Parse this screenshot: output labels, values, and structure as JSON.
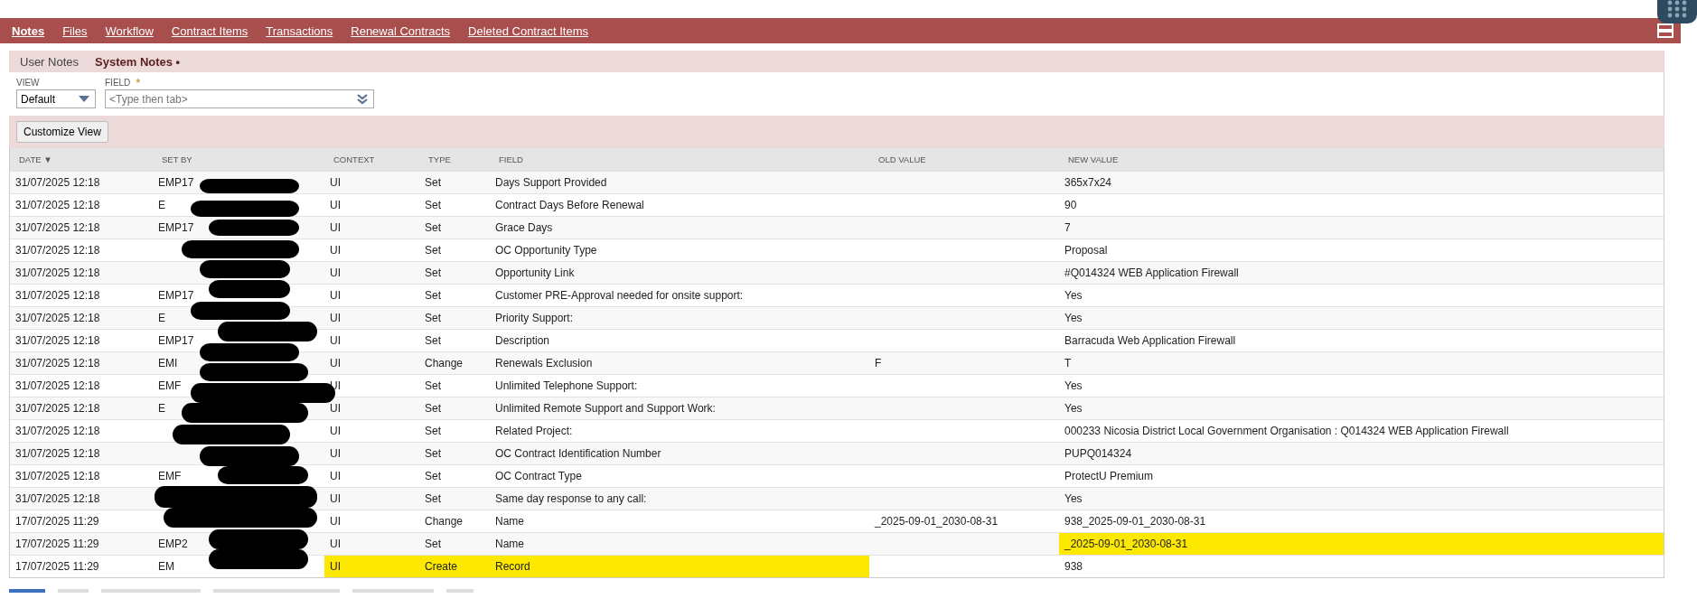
{
  "tabs": [
    {
      "label": "Notes",
      "selected": true
    },
    {
      "label": "Files",
      "selected": false
    },
    {
      "label": "Workflow",
      "selected": false
    },
    {
      "label": "Contract Items",
      "selected": false
    },
    {
      "label": "Transactions",
      "selected": false
    },
    {
      "label": "Renewal Contracts",
      "selected": false
    },
    {
      "label": "Deleted Contract Items",
      "selected": false
    }
  ],
  "subtabs": [
    {
      "label": "User Notes",
      "selected": false
    },
    {
      "label": "System Notes •",
      "selected": true
    }
  ],
  "filters": {
    "view": {
      "label": "VIEW",
      "value": "Default"
    },
    "field": {
      "label": "FIELD",
      "required_mark": "*",
      "placeholder": "<Type then tab>"
    }
  },
  "customize_button": "Customize View",
  "table": {
    "columns": [
      "DATE ▼",
      "SET BY",
      "CONTEXT",
      "TYPE",
      "FIELD",
      "OLD VALUE",
      "NEW VALUE"
    ],
    "rows": [
      {
        "date": "31/07/2025 12:18",
        "set_by": "EMP17",
        "context": "UI",
        "type": "Set",
        "field": "Days Support Provided",
        "old_value": "",
        "new_value": "365x7x24"
      },
      {
        "date": "31/07/2025 12:18",
        "set_by": "E",
        "context": "UI",
        "type": "Set",
        "field": "Contract Days Before Renewal",
        "old_value": "",
        "new_value": "90"
      },
      {
        "date": "31/07/2025 12:18",
        "set_by": "EMP17",
        "context": "UI",
        "type": "Set",
        "field": "Grace Days",
        "old_value": "",
        "new_value": "7"
      },
      {
        "date": "31/07/2025 12:18",
        "set_by": "",
        "context": "UI",
        "type": "Set",
        "field": "OC Opportunity Type",
        "old_value": "",
        "new_value": "Proposal"
      },
      {
        "date": "31/07/2025 12:18",
        "set_by": "",
        "context": "UI",
        "type": "Set",
        "field": "Opportunity Link",
        "old_value": "",
        "new_value": "#Q014324 WEB Application Firewall"
      },
      {
        "date": "31/07/2025 12:18",
        "set_by": "EMP17",
        "context": "UI",
        "type": "Set",
        "field": "Customer PRE-Approval needed for onsite support:",
        "old_value": "",
        "new_value": "Yes"
      },
      {
        "date": "31/07/2025 12:18",
        "set_by": "E",
        "context": "UI",
        "type": "Set",
        "field": "Priority Support:",
        "old_value": "",
        "new_value": "Yes"
      },
      {
        "date": "31/07/2025 12:18",
        "set_by": "EMP17",
        "context": "UI",
        "type": "Set",
        "field": "Description",
        "old_value": "",
        "new_value": "Barracuda Web Application Firewall"
      },
      {
        "date": "31/07/2025 12:18",
        "set_by": "EMI",
        "context": "UI",
        "type": "Change",
        "field": "Renewals Exclusion",
        "old_value": "F",
        "new_value": "T"
      },
      {
        "date": "31/07/2025 12:18",
        "set_by": "EMF",
        "context": "UI",
        "type": "Set",
        "field": "Unlimited Telephone Support:",
        "old_value": "",
        "new_value": "Yes"
      },
      {
        "date": "31/07/2025 12:18",
        "set_by": "E",
        "context": "UI",
        "type": "Set",
        "field": "Unlimited Remote Support and Support Work:",
        "old_value": "",
        "new_value": "Yes"
      },
      {
        "date": "31/07/2025 12:18",
        "set_by": "",
        "context": "UI",
        "type": "Set",
        "field": "Related Project:",
        "old_value": "",
        "new_value": "000233 Nicosia District Local Government Organisation : Q014324 WEB Application Firewall"
      },
      {
        "date": "31/07/2025 12:18",
        "set_by": "",
        "context": "UI",
        "type": "Set",
        "field": "OC Contract Identification Number",
        "old_value": "",
        "new_value": "PUPQ014324"
      },
      {
        "date": "31/07/2025 12:18",
        "set_by": "EMF",
        "context": "UI",
        "type": "Set",
        "field": "OC Contract Type",
        "old_value": "",
        "new_value": "ProtectU Premium"
      },
      {
        "date": "31/07/2025 12:18",
        "set_by": "",
        "context": "UI",
        "type": "Set",
        "field": "Same day response to any call:",
        "old_value": "",
        "new_value": "Yes"
      },
      {
        "date": "17/07/2025 11:29",
        "set_by": "",
        "context": "UI",
        "type": "Change",
        "field": "Name",
        "old_value": "_2025-09-01_2030-08-31",
        "new_value": "938_2025-09-01_2030-08-31"
      },
      {
        "date": "17/07/2025 11:29",
        "set_by": "EMP2",
        "context": "UI",
        "type": "Set",
        "field": "Name",
        "old_value": "",
        "new_value": "_2025-09-01_2030-08-31",
        "highlight": {
          "new_value": true
        }
      },
      {
        "date": "17/07/2025 11:29",
        "set_by": "EM",
        "context": "UI",
        "type": "Create",
        "field": "Record",
        "old_value": "",
        "new_value": "938",
        "highlight": {
          "context": true,
          "type": true,
          "field": true
        }
      }
    ]
  }
}
